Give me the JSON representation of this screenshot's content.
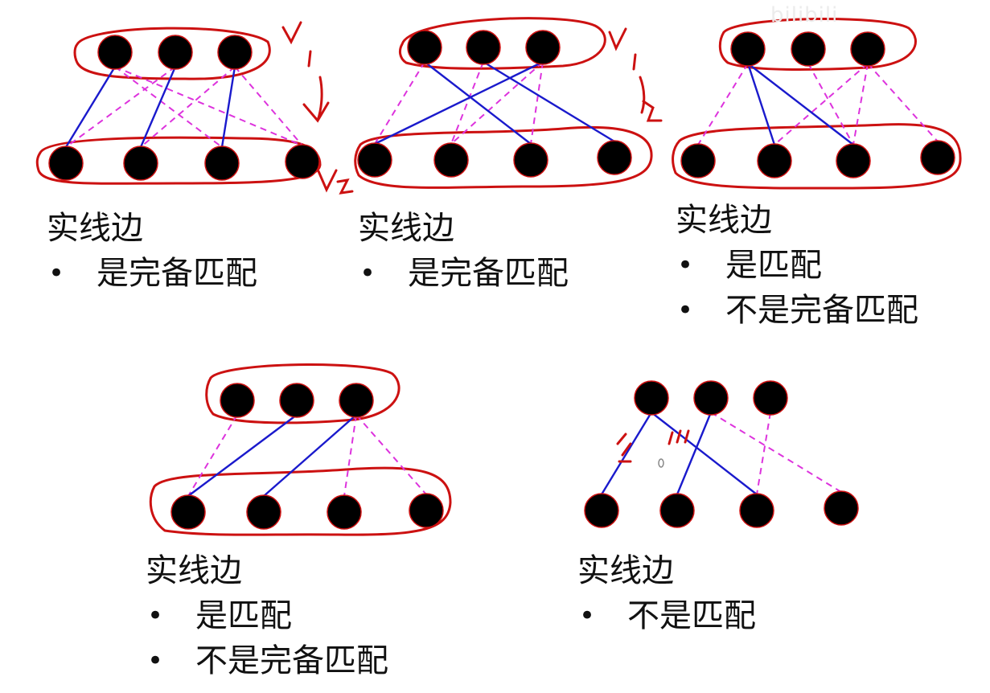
{
  "watermark": "bilibili",
  "colors": {
    "node": "#000000",
    "node_outline": "#cc1111",
    "solid_edge": "#1a1acc",
    "dashed_edge": "#dd33dd",
    "annotation": "#cc1111"
  },
  "annotations": {
    "v1": "V",
    "v1_sub": "1",
    "v2": "V",
    "v2_sub": "2"
  },
  "panels": [
    {
      "id": "p1",
      "title": "实线边",
      "bullets": [
        "是完备匹配"
      ],
      "solid_edges": [
        [
          0,
          0
        ],
        [
          1,
          1
        ],
        [
          2,
          2
        ]
      ],
      "dashed_edges": [
        [
          0,
          2
        ],
        [
          0,
          3
        ],
        [
          1,
          0
        ],
        [
          2,
          1
        ],
        [
          2,
          3
        ]
      ]
    },
    {
      "id": "p2",
      "title": "实线边",
      "bullets": [
        "是完备匹配"
      ],
      "solid_edges": [
        [
          0,
          2
        ],
        [
          1,
          3
        ],
        [
          2,
          0
        ]
      ],
      "dashed_edges": [
        [
          0,
          0
        ],
        [
          1,
          1
        ],
        [
          2,
          1
        ],
        [
          2,
          2
        ]
      ]
    },
    {
      "id": "p3",
      "title": "实线边",
      "bullets": [
        "是匹配",
        "不是完备匹配"
      ],
      "solid_edges": [
        [
          0,
          1
        ],
        [
          0,
          2
        ]
      ],
      "dashed_edges": [
        [
          0,
          0
        ],
        [
          1,
          2
        ],
        [
          2,
          1
        ],
        [
          2,
          2
        ],
        [
          2,
          3
        ]
      ]
    },
    {
      "id": "p4",
      "title": "实线边",
      "bullets": [
        "是匹配",
        "不是完备匹配"
      ],
      "solid_edges": [
        [
          1,
          0
        ],
        [
          2,
          1
        ]
      ],
      "dashed_edges": [
        [
          0,
          0
        ],
        [
          1,
          0
        ],
        [
          2,
          2
        ],
        [
          2,
          3
        ]
      ]
    },
    {
      "id": "p5",
      "title": "实线边",
      "bullets": [
        "不是匹配"
      ],
      "solid_edges": [
        [
          0,
          0
        ],
        [
          0,
          2
        ],
        [
          1,
          1
        ]
      ],
      "dashed_edges": [
        [
          1,
          3
        ],
        [
          2,
          2
        ]
      ]
    }
  ]
}
